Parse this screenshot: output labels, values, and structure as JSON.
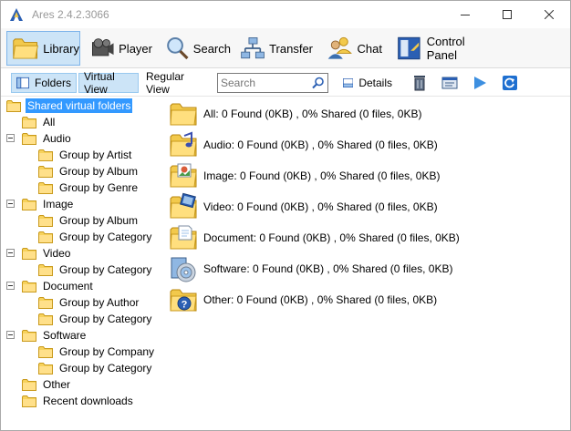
{
  "window": {
    "title": "Ares 2.4.2.3066"
  },
  "toolbar": {
    "library": "Library",
    "player": "Player",
    "search": "Search",
    "transfer": "Transfer",
    "chat": "Chat",
    "control_panel": "Control Panel"
  },
  "subbar": {
    "folders": "Folders",
    "virtual_view": "Virtual View",
    "regular_view": "Regular View",
    "search_placeholder": "Search",
    "details": "Details"
  },
  "tree": {
    "root": "Shared virtual folders",
    "all": "All",
    "audio": "Audio",
    "audio_by_artist": "Group by Artist",
    "audio_by_album": "Group by Album",
    "audio_by_genre": "Group by Genre",
    "image": "Image",
    "image_by_album": "Group by Album",
    "image_by_category": "Group by Category",
    "video": "Video",
    "video_by_category": "Group by Category",
    "document": "Document",
    "document_by_author": "Group by Author",
    "document_by_category": "Group by Category",
    "software": "Software",
    "software_by_company": "Group by Company",
    "software_by_category": "Group by Category",
    "other": "Other",
    "recent_downloads": "Recent downloads"
  },
  "content": {
    "all": "All: 0 Found (0KB) , 0% Shared (0 files, 0KB)",
    "audio": "Audio: 0 Found (0KB) , 0% Shared (0 files, 0KB)",
    "image": "Image: 0 Found (0KB) , 0% Shared (0 files, 0KB)",
    "video": "Video: 0 Found (0KB) , 0% Shared (0 files, 0KB)",
    "document": "Document: 0 Found (0KB) , 0% Shared (0 files, 0KB)",
    "software": "Software: 0 Found (0KB) , 0% Shared (0 files, 0KB)",
    "other": "Other: 0 Found (0KB) , 0% Shared (0 files, 0KB)"
  },
  "colors": {
    "selection": "#3399ff",
    "active_tab": "#cce4f7",
    "folder": "#f5c842"
  }
}
